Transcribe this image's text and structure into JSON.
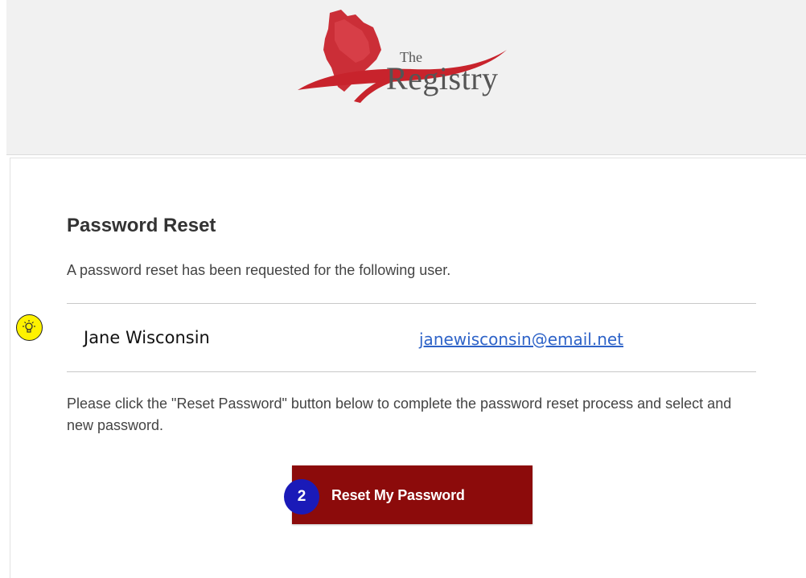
{
  "header": {
    "logo": {
      "the_text": "The",
      "name_text": "Registry",
      "icon": "wisconsin-state-swoosh-logo",
      "colors": {
        "state": "#c8232c",
        "swoosh": "#c8232c",
        "text": "#555555"
      }
    }
  },
  "main": {
    "title": "Password Reset",
    "intro": "A password reset has been requested for the following user.",
    "user": {
      "name": "Jane Wisconsin",
      "email": "janewisconsin@email.net"
    },
    "instructions": "Please click the \"Reset Password\" button below to complete the password reset process and select and new password.",
    "reset_button": "Reset My Password"
  },
  "annotations": {
    "tip_icon": "lightbulb-icon",
    "step_number": "2"
  },
  "colors": {
    "button_bg": "#8c0b0b",
    "link": "#2e63c8",
    "tip_badge": "#fff200",
    "step_badge": "#1a1ab8",
    "header_bg": "#f1f1f1"
  }
}
